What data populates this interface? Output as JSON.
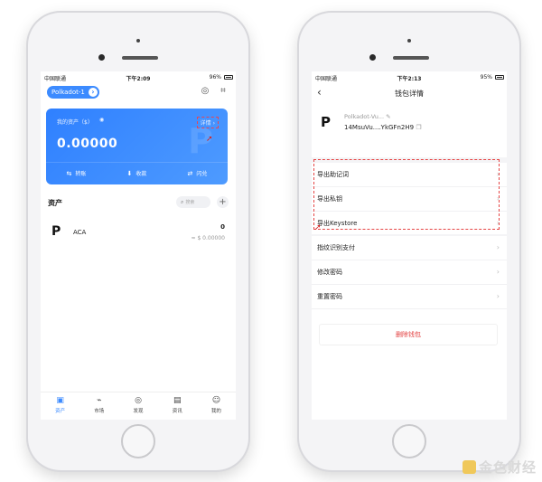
{
  "left_screen": {
    "status": {
      "carrier": "中国联通",
      "time": "下午2:09",
      "battery": "96%"
    },
    "chain_name": "Polkadot-1",
    "card": {
      "label": "我的资产（$）",
      "detail_link": "详情",
      "amount": "0.00000",
      "actions": [
        "转账",
        "收款",
        "闪兑"
      ]
    },
    "assets_title": "资产",
    "search_placeholder": "搜索",
    "asset": {
      "symbol": "ACA",
      "quantity": "0",
      "fiat": "≈ $ 0.00000"
    },
    "tabs": [
      "资产",
      "市场",
      "发现",
      "资讯",
      "我的"
    ]
  },
  "right_screen": {
    "status": {
      "carrier": "中国联通",
      "time": "下午2:13",
      "battery": "95%"
    },
    "title": "钱包详情",
    "wallet_name": "Polkadot-Vu...",
    "wallet_address": "14MsuVu....YkGFn2H9",
    "menu_group_1": [
      "导出助记词",
      "导出私钥",
      "导出Keystore"
    ],
    "menu_group_2": [
      "指纹识别支付",
      "修改密码",
      "重置密码"
    ],
    "delete_label": "删除钱包"
  },
  "brand_text": "金色财经",
  "icons": {
    "back": "chevron-left-icon",
    "chevron": "chevron-right-icon",
    "copy": "copy-icon",
    "edit": "edit-icon",
    "scan": "scan-icon",
    "camera": "camera-icon"
  },
  "colors": {
    "accent": "#3c8bff",
    "danger": "#e23d3d",
    "highlight": "#e64545"
  }
}
